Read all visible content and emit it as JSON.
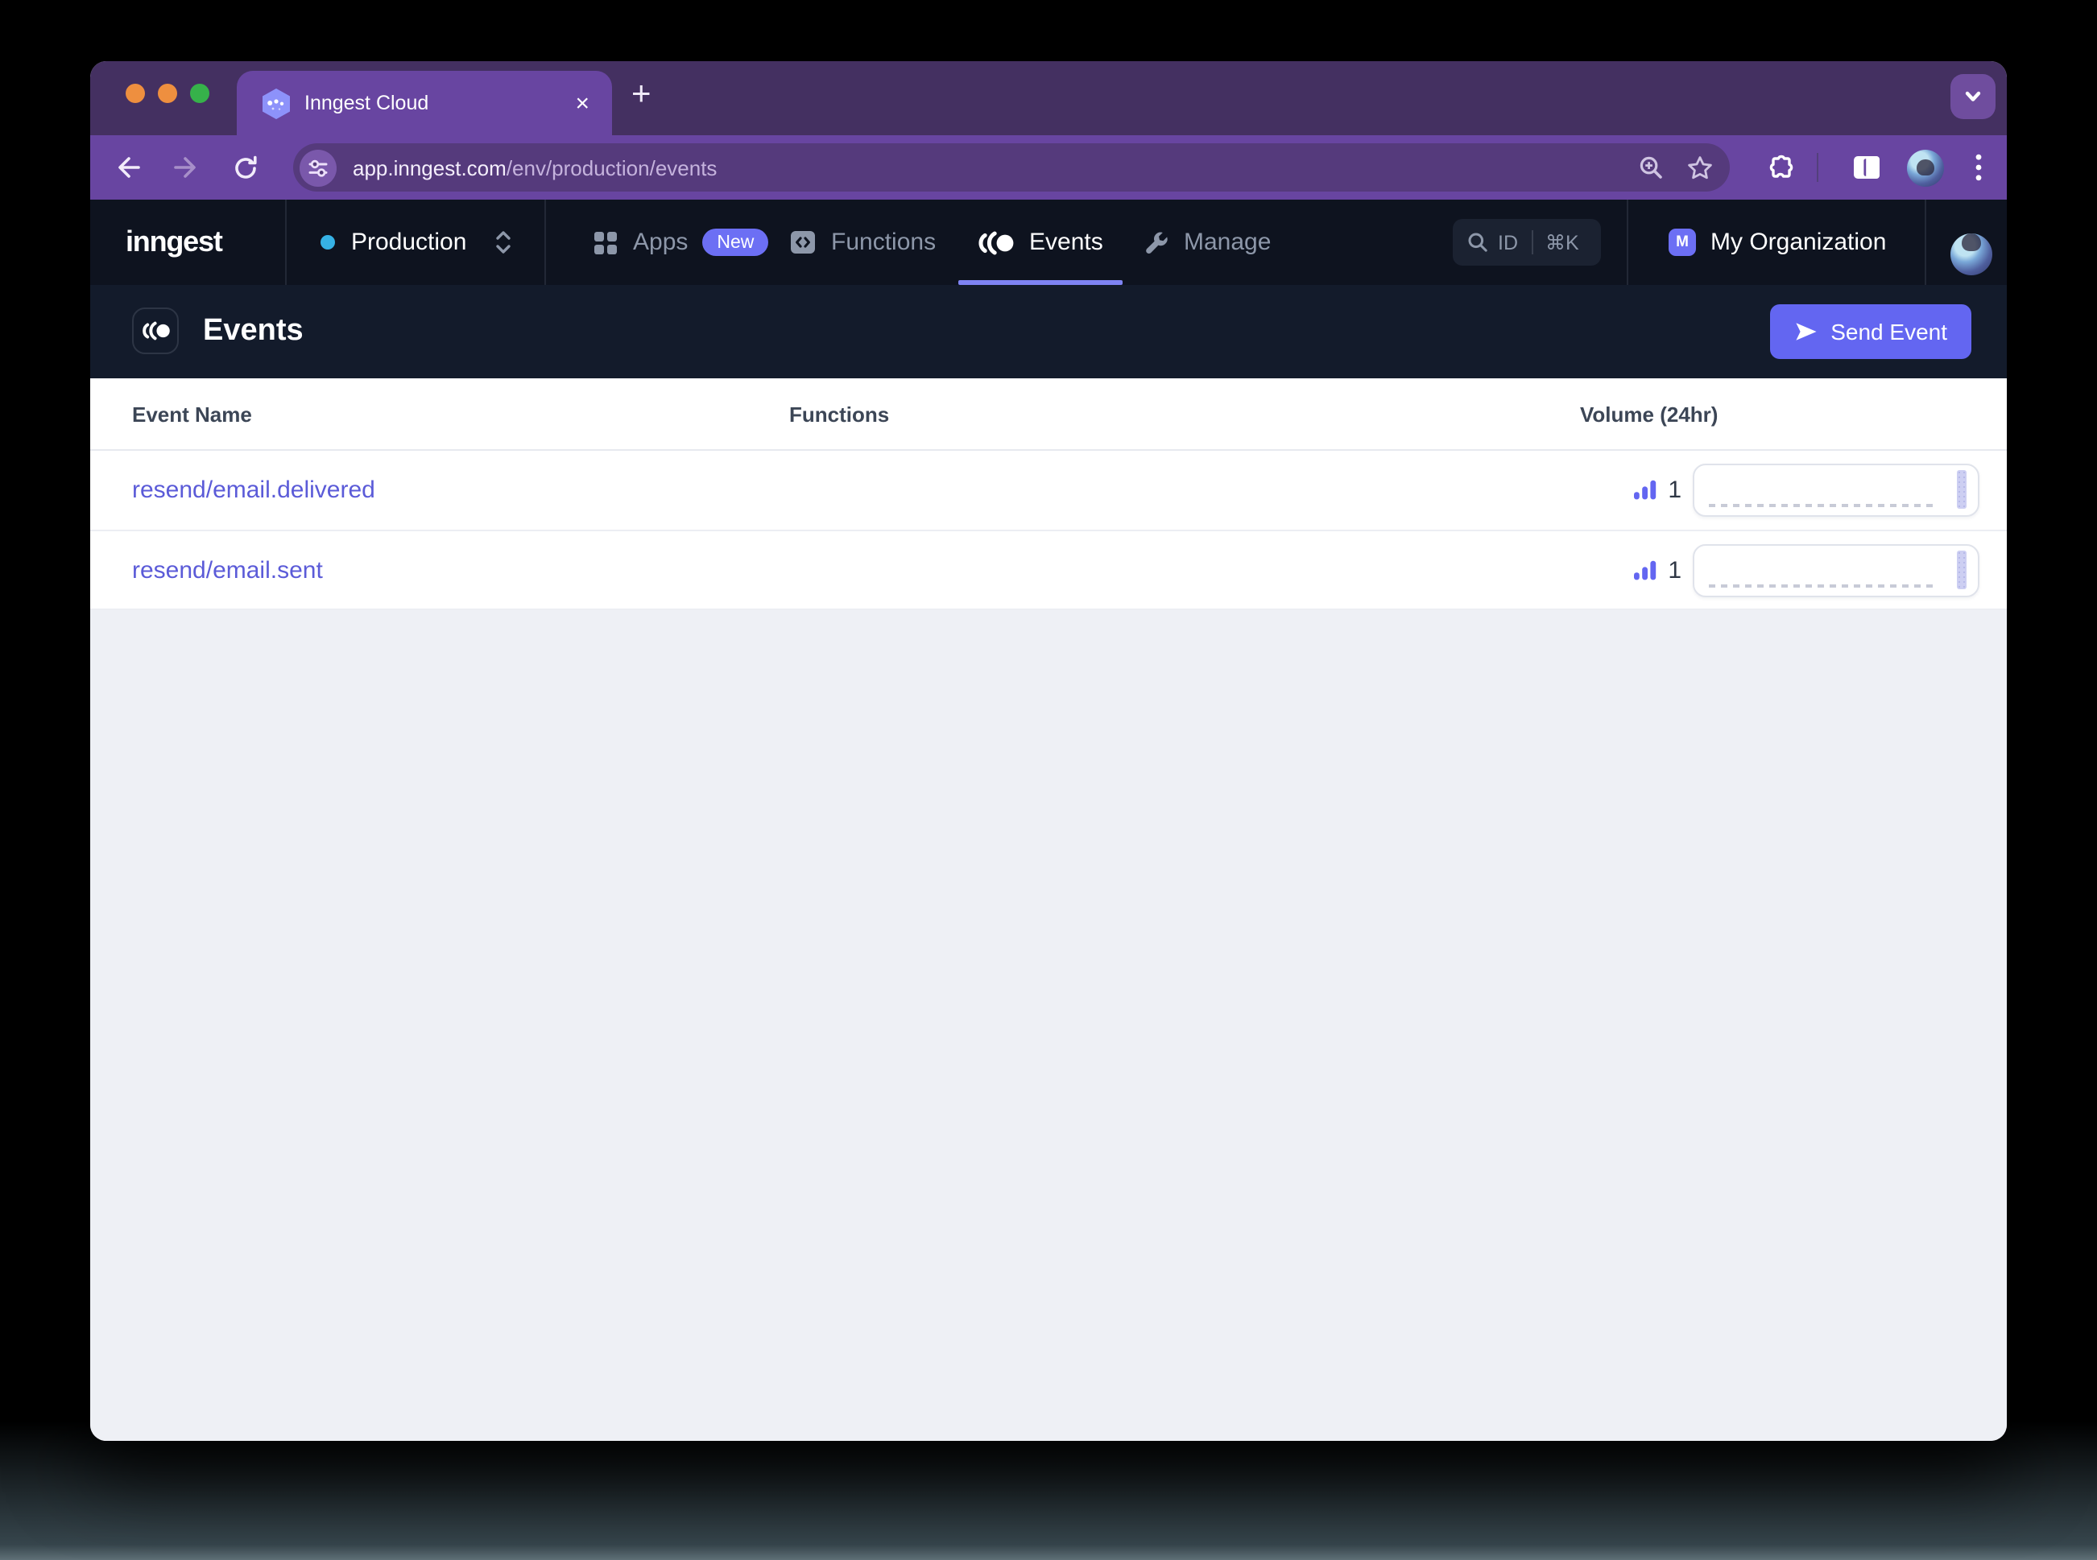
{
  "browser": {
    "tab": {
      "title": "Inngest Cloud",
      "close_glyph": "×",
      "new_tab_glyph": "+"
    },
    "url": {
      "host": "app.inngest.com",
      "path": "/env/production/events"
    }
  },
  "nav": {
    "logo": "inngest",
    "env": {
      "label": "Production",
      "status_dot_color": "#36b2e5"
    },
    "items": [
      {
        "label": "Apps",
        "badge": "New"
      },
      {
        "label": "Functions"
      },
      {
        "label": "Events",
        "active": true
      },
      {
        "label": "Manage"
      }
    ],
    "search": {
      "label": "ID",
      "shortcut": "⌘K"
    },
    "org": {
      "initial": "M",
      "name": "My Organization"
    }
  },
  "page": {
    "title": "Events",
    "send_button": "Send Event"
  },
  "table": {
    "columns": [
      "Event Name",
      "Functions",
      "Volume (24hr)"
    ],
    "rows": [
      {
        "name": "resend/email.delivered",
        "functions": "",
        "volume": "1",
        "sparkline_hours": 24,
        "sparkline_last_value": 1
      },
      {
        "name": "resend/email.sent",
        "functions": "",
        "volume": "1",
        "sparkline_hours": 24,
        "sparkline_last_value": 1
      }
    ]
  },
  "colors": {
    "accent": "#6366f1",
    "nav_underline": "#7e83f3",
    "link": "#5b5bd8",
    "badge": "#6c6ff4",
    "toolbar_purple": "#6845a1",
    "tabstrip_purple": "#443061",
    "nav_dark": "#0e131f",
    "header_dark": "#131b2b",
    "traffic_lights": [
      "#ee8f3f",
      "#ee8f3f",
      "#36b24a"
    ]
  }
}
